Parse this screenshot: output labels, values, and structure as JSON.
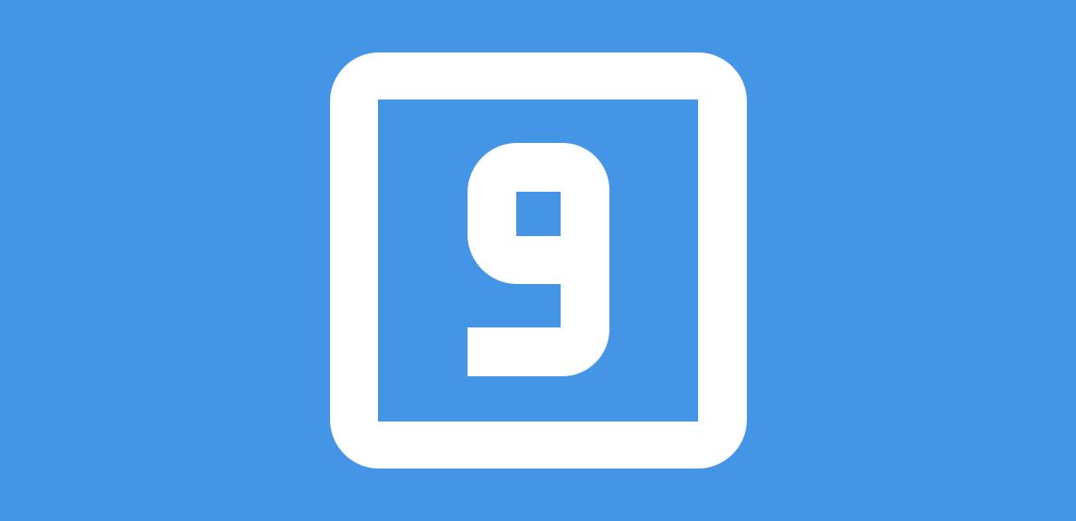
{
  "background_color": "#4595E6",
  "foreground_color": "#FFFFFF",
  "icon": {
    "name": "numeral-nine-square-icon",
    "glyph": "9"
  }
}
